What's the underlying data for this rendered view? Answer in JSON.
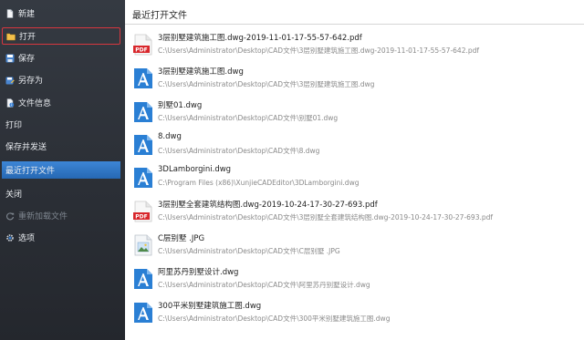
{
  "sidebar": {
    "items": [
      {
        "label": "新建",
        "icon": "new-file-icon"
      },
      {
        "label": "打开",
        "icon": "open-folder-icon"
      },
      {
        "label": "保存",
        "icon": "save-icon"
      },
      {
        "label": "另存为",
        "icon": "save-as-icon"
      },
      {
        "label": "文件信息",
        "icon": "file-info-icon"
      },
      {
        "label": "打印"
      },
      {
        "label": "保存并发送"
      },
      {
        "label": "最近打开文件"
      },
      {
        "label": "关闭"
      },
      {
        "label": "重新加载文件",
        "icon": "reload-icon"
      },
      {
        "label": "选项",
        "icon": "options-icon"
      }
    ]
  },
  "colors": {
    "sidebar_bg": "#2f333a",
    "active_item": "#2a6fbf",
    "highlight_border": "#d7373f",
    "cad_icon_blue": "#2a7fd4",
    "pdf_icon_red": "#d8262b"
  },
  "main": {
    "title": "最近打开文件",
    "files": [
      {
        "type": "pdf",
        "icon": "pdf-file-icon",
        "name": "3层别墅建筑施工图.dwg-2019-11-01-17-55-57-642.pdf",
        "path": "C:\\Users\\Administrator\\Desktop\\CAD文件\\3层别墅建筑施工图.dwg-2019-11-01-17-55-57-642.pdf"
      },
      {
        "type": "dwg",
        "icon": "cad-file-icon",
        "name": "3层别墅建筑施工图.dwg",
        "path": "C:\\Users\\Administrator\\Desktop\\CAD文件\\3层别墅建筑施工图.dwg"
      },
      {
        "type": "dwg",
        "icon": "cad-file-icon",
        "name": "别墅01.dwg",
        "path": "C:\\Users\\Administrator\\Desktop\\CAD文件\\别墅01.dwg"
      },
      {
        "type": "dwg",
        "icon": "cad-file-icon",
        "name": "8.dwg",
        "path": "C:\\Users\\Administrator\\Desktop\\CAD文件\\8.dwg"
      },
      {
        "type": "dwg",
        "icon": "cad-file-icon",
        "name": "3DLamborgini.dwg",
        "path": "C:\\Program Files (x86)\\XunjieCADEditor\\3DLamborgini.dwg"
      },
      {
        "type": "pdf",
        "icon": "pdf-file-icon",
        "name": "3层别墅全套建筑结构图.dwg-2019-10-24-17-30-27-693.pdf",
        "path": "C:\\Users\\Administrator\\Desktop\\CAD文件\\3层别墅全套建筑结构图.dwg-2019-10-24-17-30-27-693.pdf"
      },
      {
        "type": "image",
        "icon": "image-file-icon",
        "name": "C层别墅 .JPG",
        "path": "C:\\Users\\Administrator\\Desktop\\CAD文件\\C层别墅 .JPG"
      },
      {
        "type": "dwg",
        "icon": "cad-file-icon",
        "name": "阿里苏丹别墅设计.dwg",
        "path": "C:\\Users\\Administrator\\Desktop\\CAD文件\\阿里苏丹别墅设计.dwg"
      },
      {
        "type": "dwg",
        "icon": "cad-file-icon",
        "name": "300平米别墅建筑施工图.dwg",
        "path": "C:\\Users\\Administrator\\Desktop\\CAD文件\\300平米别墅建筑施工图.dwg"
      }
    ]
  }
}
